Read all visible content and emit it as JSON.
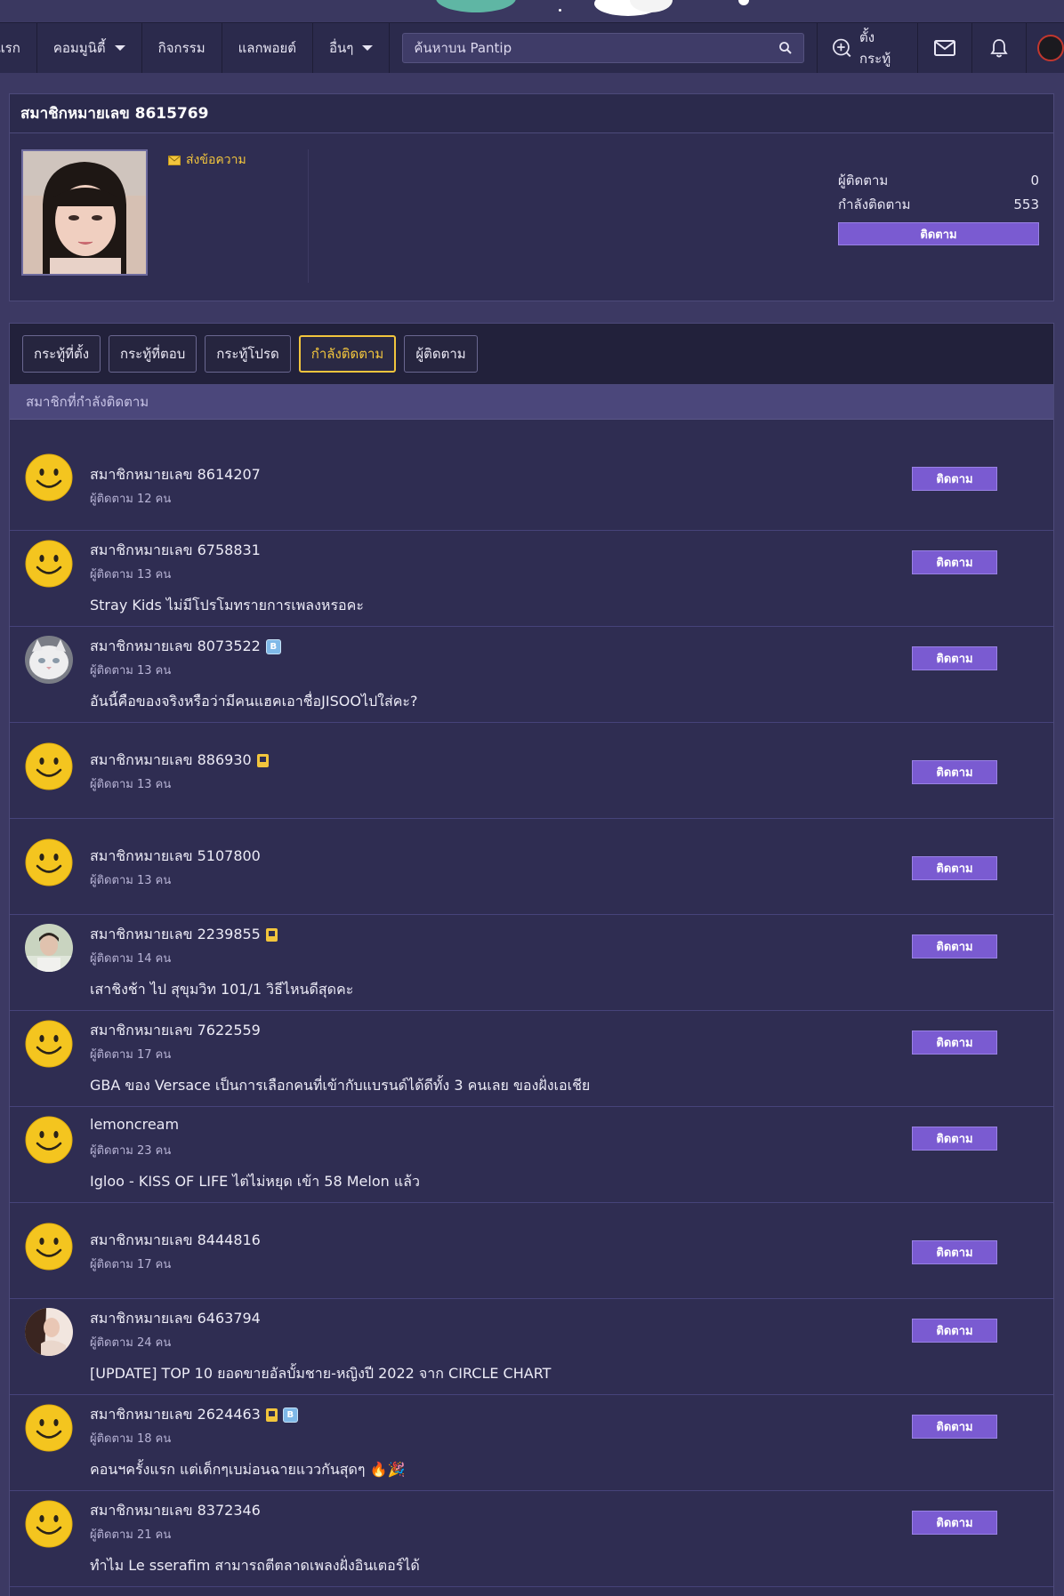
{
  "nav": {
    "home_partial": "แรก",
    "community": "คอมมูนิตี้",
    "activities": "กิจกรรม",
    "redeem_points": "แลกพอยต์",
    "others": "อื่นๆ",
    "search_placeholder": "ค้นหาบน Pantip",
    "new_post": "ตั้งกระทู้"
  },
  "profile": {
    "title": "สมาชิกหมายเลข 8615769",
    "send_message": "ส่งข้อความ",
    "followers_label": "ผู้ติดตาม",
    "followers_value": "0",
    "following_label": "กำลังติดตาม",
    "following_value": "553",
    "follow_button": "ติดตาม"
  },
  "tabs": [
    {
      "label": "กระทู้ที่ตั้ง",
      "active": false
    },
    {
      "label": "กระทู้ที่ตอบ",
      "active": false
    },
    {
      "label": "กระทู้โปรด",
      "active": false
    },
    {
      "label": "กำลังติดตาม",
      "active": true
    },
    {
      "label": "ผู้ติดตาม",
      "active": false
    }
  ],
  "section_title": "สมาชิกที่กำลังติดตาม",
  "members": [
    {
      "name": "สมาชิกหมายเลข 8614207",
      "followers": "ผู้ติดตาม 12 คน",
      "topic": "",
      "avatar": "smiley",
      "badges": [],
      "button": "ติดตาม"
    },
    {
      "name": "สมาชิกหมายเลข 6758831",
      "followers": "ผู้ติดตาม 13 คน",
      "topic": "Stray Kids ไม่มีโปรโมทรายการเพลงหรอคะ",
      "avatar": "smiley",
      "badges": [],
      "button": "ติดตาม"
    },
    {
      "name": "สมาชิกหมายเลข 8073522",
      "followers": "ผู้ติดตาม 13 คน",
      "topic": "อันนี้คือของจริงหรือว่ามีคนแฮคเอาชื่อJISOOไปใส่คะ?",
      "avatar": "cat",
      "badges": [
        "blog"
      ],
      "button": "ติดตาม"
    },
    {
      "name": "สมาชิกหมายเลข 886930",
      "followers": "ผู้ติดตาม 13 คน",
      "topic": "",
      "avatar": "smiley",
      "badges": [
        "pen"
      ],
      "button": "ติดตาม"
    },
    {
      "name": "สมาชิกหมายเลข 5107800",
      "followers": "ผู้ติดตาม 13 คน",
      "topic": "",
      "avatar": "smiley",
      "badges": [],
      "button": "ติดตาม"
    },
    {
      "name": "สมาชิกหมายเลข 2239855",
      "followers": "ผู้ติดตาม 14 คน",
      "topic": "เสาชิงช้า ไป สุขุมวิท 101/1 วิธีไหนดีสุดคะ",
      "avatar": "photo-light",
      "badges": [
        "pen"
      ],
      "button": "ติดตาม"
    },
    {
      "name": "สมาชิกหมายเลข 7622559",
      "followers": "ผู้ติดตาม 17 คน",
      "topic": "GBA ของ Versace เป็นการเลือกคนที่เข้ากับแบรนด์ได้ดีทั้ง 3 คนเลย ของฝั่งเอเชีย",
      "avatar": "smiley",
      "badges": [],
      "button": "ติดตาม"
    },
    {
      "name": "lemoncream",
      "followers": "ผู้ติดตาม 23 คน",
      "topic": "Igloo - KISS OF LIFE ไต่ไม่หยุด เข้า 58 Melon แล้ว",
      "avatar": "smiley",
      "badges": [],
      "button": "ติดตาม"
    },
    {
      "name": "สมาชิกหมายเลข 8444816",
      "followers": "ผู้ติดตาม 17 คน",
      "topic": "",
      "avatar": "smiley",
      "badges": [],
      "button": "ติดตาม"
    },
    {
      "name": "สมาชิกหมายเลข 6463794",
      "followers": "ผู้ติดตาม 24 คน",
      "topic": "[UPDATE] TOP 10 ยอดขายอัลบั้มชาย-หญิงปี 2022 จาก CIRCLE CHART",
      "avatar": "photo-dark",
      "badges": [],
      "button": "ติดตาม"
    },
    {
      "name": "สมาชิกหมายเลข 2624463",
      "followers": "ผู้ติดตาม 18 คน",
      "topic": "คอนฯครั้งแรก แต่เด็กๆเบม่อนฉายแววกันสุดๆ 🔥🎉",
      "avatar": "smiley",
      "badges": [
        "pen",
        "blog"
      ],
      "button": "ติดตาม"
    },
    {
      "name": "สมาชิกหมายเลข 8372346",
      "followers": "ผู้ติดตาม 21 คน",
      "topic": "ทำไม Le sserafim สามารถตีตลาดเพลงฝั่งอินเตอร์ได้",
      "avatar": "smiley",
      "badges": [],
      "button": "ติดตาม"
    }
  ],
  "colors": {
    "accent": "#7a5bd1",
    "active_tab": "#f2c53d",
    "page_bg": "#3c3963",
    "panel_bg": "#2f2d52"
  }
}
